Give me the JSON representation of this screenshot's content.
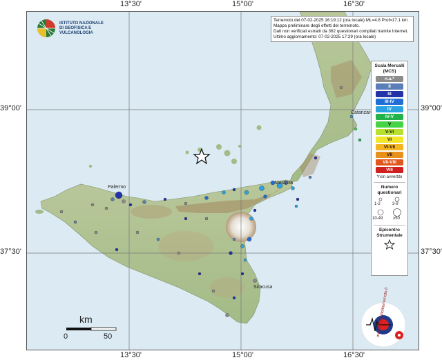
{
  "info": {
    "lines": [
      "Terremoto del 07-02-2025 16:19:12 (ora locale) ML=4.8 Prof=17.1 km",
      "Mappa preliminare degli effetti del terremoto.",
      "Dati non verificati estratti da 362 questionari compilati tramite Internet.",
      "Ultimo aggiornamento: 07-02-2025 17:29 (ora locale)"
    ]
  },
  "logo": {
    "line1": "ISTITUTO NAZIONALE",
    "line2": "DI GEOFISICA E VULCANOLOGIA"
  },
  "coords": {
    "top": [
      "13°30'",
      "15°00'",
      "16°30'"
    ],
    "bottom": [
      "13°30'",
      "15°00'",
      "16°30'"
    ],
    "left": [
      "39°00'",
      "37°30'"
    ],
    "right": [
      "39°00'",
      "37°30'"
    ]
  },
  "cities": {
    "palermo": "Palermo",
    "messina": "Messina",
    "catanzaro": "Catanzaro",
    "siracusa": "Siracusa"
  },
  "legend": {
    "title": "Scala Mercalli (MCS)",
    "levels": [
      {
        "label": "n.a.*",
        "color": "#8c8c8c",
        "text": "#ffffff"
      },
      {
        "label": "II",
        "color": "#5a7fb8",
        "text": "#ffffff"
      },
      {
        "label": "III",
        "color": "#2233a8",
        "text": "#ffffff"
      },
      {
        "label": "III-IV",
        "color": "#1f6fd6",
        "text": "#ffffff"
      },
      {
        "label": "IV",
        "color": "#2aa3e0",
        "text": "#ffffff"
      },
      {
        "label": "IV-V",
        "color": "#21b24a",
        "text": "#ffffff"
      },
      {
        "label": "V",
        "color": "#46d446",
        "text": "#111111"
      },
      {
        "label": "V-VI",
        "color": "#b8e02e",
        "text": "#111111"
      },
      {
        "label": "VI",
        "color": "#f2e52a",
        "text": "#111111"
      },
      {
        "label": "VI-VII",
        "color": "#f5b522",
        "text": "#111111"
      },
      {
        "label": "VII",
        "color": "#e8901c",
        "text": "#111111"
      },
      {
        "label": "VII-VIII",
        "color": "#e2561e",
        "text": "#ffffff"
      },
      {
        "label": "VIII",
        "color": "#d01f1f",
        "text": "#ffffff"
      }
    ],
    "footnote": "*non avvertito",
    "numero_title": "Numero questionari",
    "sizes": [
      "1-2",
      "3-9",
      "10-49",
      "≥50"
    ],
    "epicentro_title": "Epicentro Strumentale"
  },
  "scale": {
    "unit": "km",
    "start": "0",
    "end": "50"
  },
  "brand": {
    "text": "www.haisentitoilterremoto.it"
  }
}
